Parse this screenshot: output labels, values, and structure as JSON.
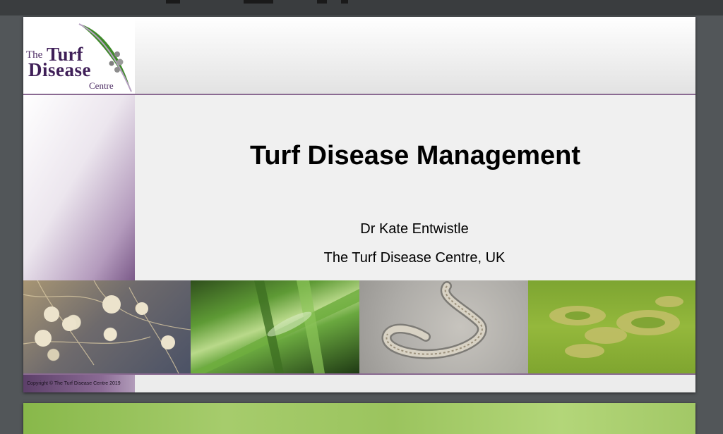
{
  "logo": {
    "the": "The",
    "turf": "Turf",
    "disease": "Disease",
    "centre": "Centre"
  },
  "slide": {
    "title": "Turf Disease Management",
    "author": "Dr Kate Entwistle",
    "organisation": "The Turf Disease Centre, UK",
    "copyright": "Copyright © The Turf Disease Centre 2019"
  },
  "photos": [
    {
      "name": "root-nodules-photo"
    },
    {
      "name": "grass-blade-photo"
    },
    {
      "name": "nematode-photo"
    },
    {
      "name": "diseased-turf-photo"
    }
  ],
  "colors": {
    "brand_purple": "#3f1f58",
    "accent_rule": "#8a6a92",
    "leaf_green": "#3f8a2a",
    "viewer_background": "#525659"
  }
}
